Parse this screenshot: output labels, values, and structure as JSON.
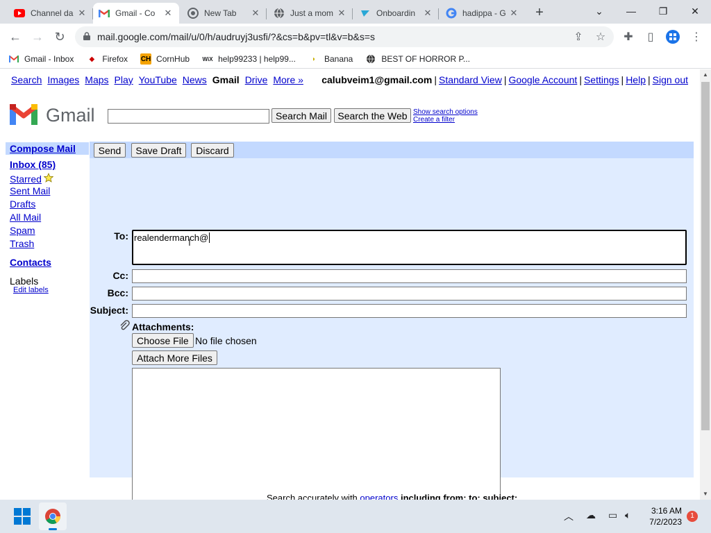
{
  "browser": {
    "tabs": [
      {
        "title": "Channel da",
        "icon": "youtube-icon"
      },
      {
        "title": "Gmail - Co",
        "icon": "gmail-icon",
        "active": true
      },
      {
        "title": "New Tab",
        "icon": "chrome-icon"
      },
      {
        "title": "Just a mom",
        "icon": "globe-icon"
      },
      {
        "title": "Onboardin",
        "icon": "onboarding-icon"
      },
      {
        "title": "hadippa - G",
        "icon": "google-icon"
      }
    ],
    "url": "mail.google.com/mail/u/0/h/audruyj3usfi/?&cs=b&pv=tl&v=b&s=s",
    "bookmarks": [
      {
        "label": "Gmail - Inbox",
        "icon": "gmail-icon"
      },
      {
        "label": "Firefox",
        "icon": "bird-icon"
      },
      {
        "label": "CornHub",
        "icon": "cornhub-icon"
      },
      {
        "label": "help99233 | help99...",
        "icon": "wix-icon"
      },
      {
        "label": "Banana",
        "icon": "banana-icon"
      },
      {
        "label": "BEST OF HORROR P...",
        "icon": "globe-icon"
      }
    ]
  },
  "gbar": {
    "links": [
      "Search",
      "Images",
      "Maps",
      "Play",
      "YouTube",
      "News",
      "Gmail",
      "Drive",
      "More »"
    ],
    "email": "calubveim1@gmail.com",
    "right_links": [
      "Standard View",
      "Google Account",
      "Settings",
      "Help",
      "Sign out"
    ]
  },
  "header": {
    "logo_text": "Gmail",
    "search_mail": "Search Mail",
    "search_web": "Search the Web",
    "show_options": "Show search options",
    "create_filter": "Create a filter"
  },
  "leftnav": {
    "compose": "Compose Mail",
    "inbox": "Inbox (85)",
    "starred": "Starred",
    "sent": "Sent Mail",
    "drafts": "Drafts",
    "all": "All Mail",
    "spam": "Spam",
    "trash": "Trash",
    "contacts": "Contacts",
    "labels": "Labels",
    "edit_labels": "Edit labels"
  },
  "compose": {
    "send": "Send",
    "save_draft": "Save Draft",
    "discard": "Discard",
    "to_label": "To:",
    "to_value": "realendermanch@",
    "cc_label": "Cc:",
    "bcc_label": "Bcc:",
    "subject_label": "Subject:",
    "attachments_label": "Attachments:",
    "choose_file": "Choose File",
    "no_file": "No file chosen",
    "attach_more": "Attach More Files"
  },
  "footer": {
    "pre": "Search accurately with",
    "link": "operators",
    "post": "including from:  to:  subject:"
  },
  "taskbar": {
    "time": "3:16 AM",
    "date": "7/2/2023",
    "notifications": "1"
  }
}
